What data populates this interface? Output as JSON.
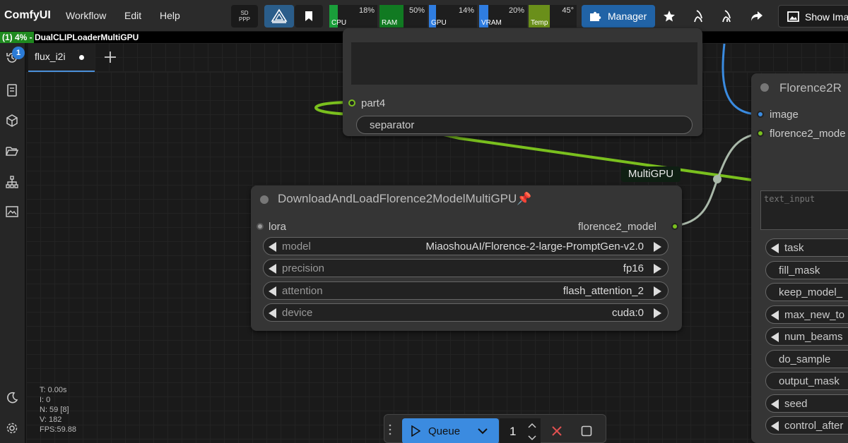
{
  "app": {
    "brand": "ComfyUI",
    "menus": [
      "Workflow",
      "Edit",
      "Help"
    ],
    "sdppp_label_1": "SD",
    "sdppp_label_2": "PPP",
    "manager_label": "Manager",
    "show_image_label": "Show Ima"
  },
  "monitors": [
    {
      "label": "CPU",
      "value": "18%",
      "color": "#1a9e3a",
      "fraction": 0.18
    },
    {
      "label": "RAM",
      "value": "50%",
      "color": "#117a22",
      "fraction": 0.5
    },
    {
      "label": "GPU",
      "value": "14%",
      "color": "#2f7de1",
      "fraction": 0.14
    },
    {
      "label": "VRAM",
      "value": "20%",
      "color": "#2f7de1",
      "fraction": 0.2
    },
    {
      "label": "Temp",
      "value": "45°",
      "color": "#6a8f1a",
      "fraction": 0.45
    }
  ],
  "progress": {
    "text": "(1) 4% - DualCLIPLoaderMultiGPU",
    "fraction": 0.04
  },
  "sidebar": {
    "queue_badge": "1"
  },
  "tabs": [
    {
      "label": "flux_i2i",
      "modified": true
    }
  ],
  "nodes": {
    "top_node": {
      "output_label": "part4",
      "separator_label": "separator"
    },
    "download_node": {
      "title": "DownloadAndLoadFlorence2ModelMultiGPU📌",
      "input_label": "lora",
      "output_label": "florence2_model",
      "widgets": [
        {
          "name": "model",
          "value": "MiaoshouAI/Florence-2-large-PromptGen-v2.0"
        },
        {
          "name": "precision",
          "value": "fp16"
        },
        {
          "name": "attention",
          "value": "flash_attention_2"
        },
        {
          "name": "device",
          "value": "cuda:0"
        }
      ]
    },
    "florence_node": {
      "title": "Florence2R",
      "inputs": [
        "image",
        "florence2_mode"
      ],
      "text_placeholder": "text_input",
      "widgets": [
        "task",
        "fill_mask",
        "keep_model_",
        "max_new_to",
        "num_beams",
        "do_sample",
        "output_mask",
        "seed",
        "control_after"
      ]
    },
    "group_label": "MultiGPU"
  },
  "stats": {
    "t": "T: 0.00s",
    "i": "I: 0",
    "n": "N: 59 [8]",
    "v": "V: 182",
    "fps": "FPS:59.88"
  },
  "queue": {
    "button_label": "Queue",
    "count": "1"
  },
  "colors": {
    "accent_blue": "#3b8be0",
    "wire_green": "#7ac01e",
    "wire_blue": "#3a8be0",
    "wire_gray": "#a9b8a9"
  }
}
